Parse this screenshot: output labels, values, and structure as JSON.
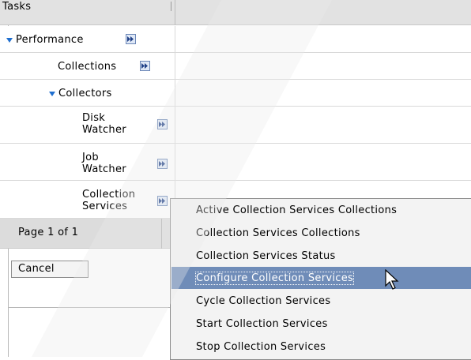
{
  "tasks_header": "Tasks",
  "tree": {
    "performance": "Performance",
    "collections": "Collections",
    "collectors": "Collectors",
    "disk_watcher": [
      "Disk",
      "Watcher"
    ],
    "job_watcher": [
      "Job",
      "Watcher"
    ],
    "collection_services": [
      "Collection",
      "Services"
    ]
  },
  "pager": "Page 1 of 1",
  "cancel_label": "Cancel",
  "context_menu": {
    "items": [
      "Active Collection Services Collections",
      "Collection Services Collections",
      "Collection Services Status",
      "Configure Collection Services",
      "Cycle Collection Services",
      "Start Collection Services",
      "Stop Collection Services"
    ],
    "selected": "Configure Collection Services"
  },
  "icons": {
    "expand": "triangle-down-icon",
    "menu": "menu-arrow-icon",
    "cursor": "mouse-pointer-icon"
  },
  "colors": {
    "selected_item_bg": "#6f8cb8",
    "tree_triangle": "#1f6fcf"
  }
}
